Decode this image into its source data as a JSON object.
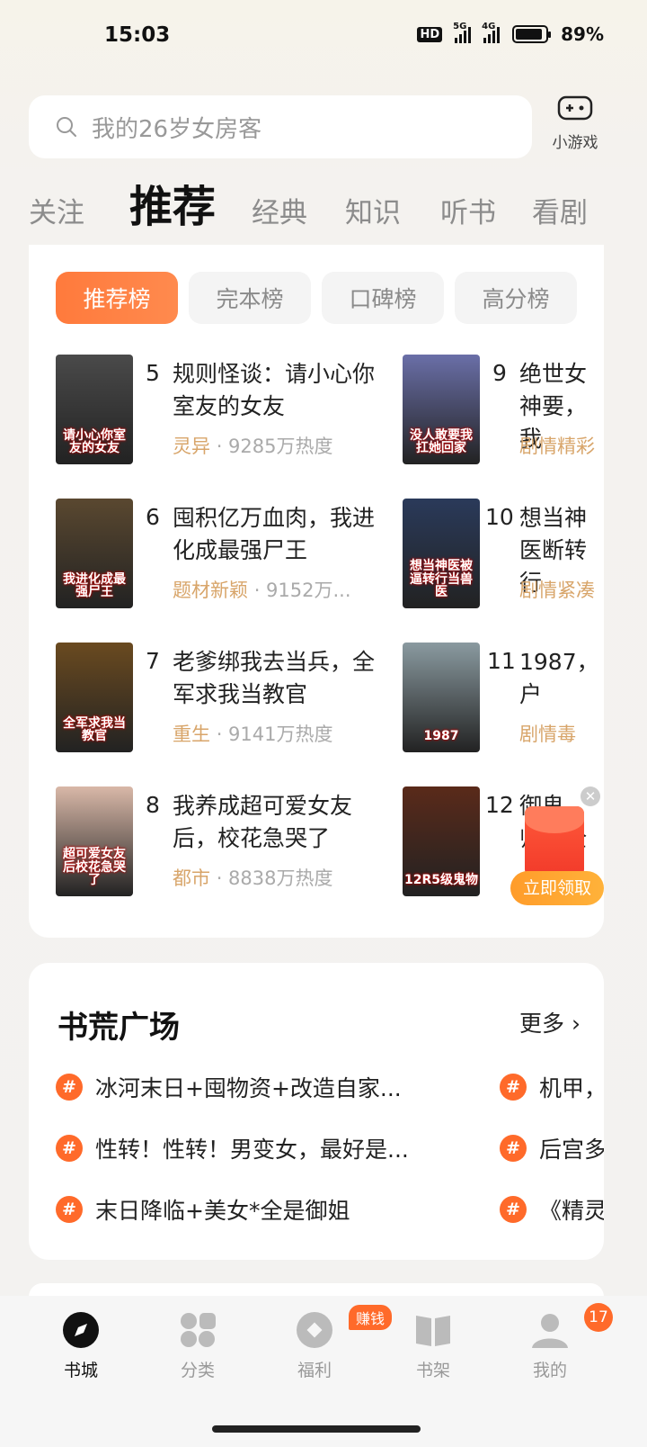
{
  "status_bar": {
    "time": "15:03",
    "hd": "HD",
    "net1": "5G",
    "net2": "4G",
    "battery_text": "89%",
    "battery_level": 0.89
  },
  "search": {
    "placeholder": "我的26岁女房客"
  },
  "game": {
    "label": "小游戏"
  },
  "top_tabs": [
    {
      "label": "关注"
    },
    {
      "label": "推荐"
    },
    {
      "label": "经典"
    },
    {
      "label": "知识"
    },
    {
      "label": "听书"
    },
    {
      "label": "看剧"
    }
  ],
  "rank_tabs": [
    {
      "label": "推荐榜"
    },
    {
      "label": "完本榜"
    },
    {
      "label": "口碑榜"
    },
    {
      "label": "高分榜"
    }
  ],
  "books_left": [
    {
      "rank": "5",
      "title": "规则怪谈：请小心你室友的女友",
      "genre": "灵异",
      "heat": "· 9285万热度",
      "cover_text": "请小心你室友的女友",
      "cover_color": "#4a4a4a"
    },
    {
      "rank": "6",
      "title": "囤积亿万血肉，我进化成最强尸王",
      "genre": "题材新颖",
      "heat": "· 9152万...",
      "cover_text": "我进化成最强尸王",
      "cover_color": "#5a4830"
    },
    {
      "rank": "7",
      "title": "老爹绑我去当兵，全军求我当教官",
      "genre": "重生",
      "heat": "· 9141万热度",
      "cover_text": "全军求我当教官",
      "cover_color": "#6a4a20"
    },
    {
      "rank": "8",
      "title": "我养成超可爱女友后，校花急哭了",
      "genre": "都市",
      "heat": "· 8838万热度",
      "cover_text": "超可爱女友后校花急哭了",
      "cover_color": "#d9b8a8"
    }
  ],
  "books_right": [
    {
      "rank": "9",
      "title": "绝世女神要，我",
      "genre": "剧情精彩",
      "cover_text": "没人敢要我扛她回家",
      "cover_color": "#6a6fa8"
    },
    {
      "rank": "10",
      "title": "想当神医断转行",
      "genre": "剧情紧凑",
      "cover_text": "想当神医被逼转行当兽医",
      "cover_color": "#2a3a5a"
    },
    {
      "rank": "11",
      "title": "1987，户",
      "genre": "剧情毒",
      "cover_text": "1987",
      "cover_color": "#8a9aa0"
    },
    {
      "rank": "12",
      "title": "御鬼师，全",
      "genre": "",
      "cover_text": "12R5级鬼物",
      "cover_color": "#5a2a1a"
    }
  ],
  "red_packet": {
    "button": "立即领取"
  },
  "square": {
    "title": "书荒广场",
    "more": "更多 ›",
    "topics_left": [
      "冰河末日+囤物资+改造自家...",
      "性转！性转！男变女，最好是...",
      "末日降临+美女*全是御姐"
    ],
    "topics_right": [
      "机甲，",
      "后宫多",
      "《精灵"
    ]
  },
  "nav": [
    {
      "label": "书城"
    },
    {
      "label": "分类"
    },
    {
      "label": "福利",
      "badge": "赚钱"
    },
    {
      "label": "书架"
    },
    {
      "label": "我的",
      "badge": "17"
    }
  ],
  "colors": {
    "accent": "#ff6a2a",
    "genre": "#d8a56a"
  }
}
